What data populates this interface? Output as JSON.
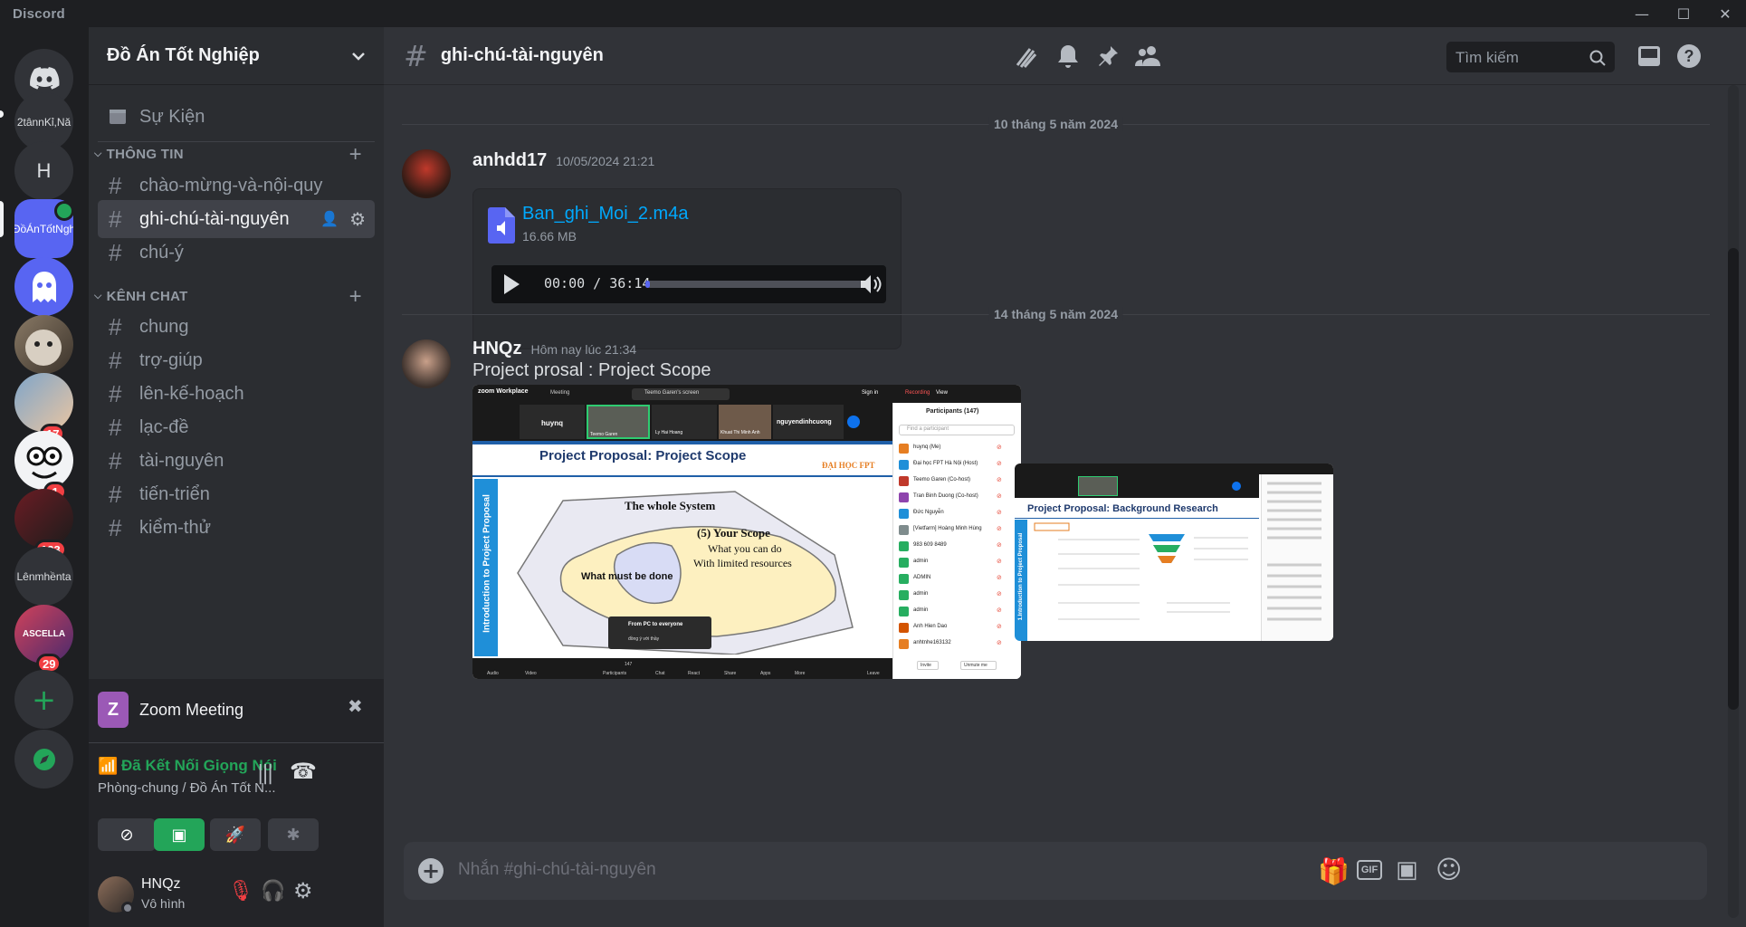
{
  "window": {
    "brand": "Discord",
    "minimize_glyph": "—",
    "maximize_glyph": "☐",
    "close_glyph": "✕"
  },
  "guilds": [
    {
      "label": "2tânnKỉ,Nă",
      "kind": "text"
    },
    {
      "label": "H",
      "kind": "letter"
    },
    {
      "label": "ĐồÁnTốtNgh",
      "kind": "text-active"
    },
    {
      "label": "",
      "kind": "ghost"
    },
    {
      "label": "",
      "kind": "avatar"
    },
    {
      "label": "",
      "kind": "avatar",
      "badge": "17"
    },
    {
      "label": "",
      "kind": "avatar",
      "badge": "1"
    },
    {
      "label": "",
      "kind": "avatar",
      "badge": "133"
    },
    {
      "label": "Lênmhềnta",
      "kind": "text"
    },
    {
      "label": "ASCELLA",
      "kind": "avatar",
      "badge": "29"
    }
  ],
  "server": {
    "name": "Đồ Án Tốt Nghiệp"
  },
  "sidebar": {
    "events": "Sự Kiện",
    "categories": [
      {
        "name": "THÔNG TIN",
        "channels": [
          "chào-mừng-và-nội-quy",
          "ghi-chú-tài-nguyên",
          "chú-ý"
        ]
      },
      {
        "name": "KÊNH CHAT",
        "channels": [
          "chung",
          "trợ-giúp",
          "lên-kế-hoạch",
          "lạc-đề",
          "tài-nguyên",
          "tiến-triển",
          "kiểm-thử"
        ]
      }
    ]
  },
  "activity": {
    "title": "Zoom Meeting",
    "icon_letter": "Z"
  },
  "voice": {
    "status": "Đã Kết Nối Giọng Nói",
    "location": "Phòng-chung / Đồ Án Tốt N..."
  },
  "user": {
    "name": "HNQz",
    "status": "Vô hình"
  },
  "channel": {
    "name": "ghi-chú-tài-nguyên"
  },
  "search": {
    "placeholder": "Tìm kiếm"
  },
  "messages": {
    "divider1": "10 tháng 5 năm 2024",
    "m1": {
      "author": "anhdd17",
      "timestamp": "10/05/2024 21:21",
      "file_name": "Ban_ghi_Moi_2.m4a",
      "file_size": "16.66 MB",
      "time": "00:00 / 36:14",
      "progress": 0.02
    },
    "divider2": "14 tháng 5 năm 2024",
    "m2": {
      "author": "HNQz",
      "timestamp": "Hôm nay lúc 21:34",
      "text": "Project prosal : Project Scope",
      "shot1": {
        "brand": "zoom Workplace",
        "meeting": "Meeting",
        "share_banner": "Teemo Garen's screen",
        "sign_in": "Sign in",
        "recording": "Recording",
        "view": "View",
        "tiles": [
          "huynq",
          "Teemo Garen",
          "Ly Hai Hoang",
          "Khuat Thi Minh Anh",
          "nguyendinhcuong"
        ],
        "slide_title": "Project Proposal: Project Scope",
        "logo_text": "ĐẠI HỌC FPT",
        "side_text": "Introduction to Project Proposal",
        "whole": "The whole System",
        "scope": "(5) Your Scope",
        "scope2": "What you can do",
        "scope3": "With limited resources",
        "must": "What must be done",
        "chat_popup_title": "From PC to everyone",
        "chat_popup_text": "đồng ý với thầy",
        "participants_title": "Participants (147)",
        "find": "Find a participant",
        "participants": [
          "huynq (Me)",
          "Đại học FPT Hà Nội (Host)",
          "Teemo Garen (Co-host)",
          "Tran Binh Duong (Co-host)",
          "Đức Nguyễn",
          "[Vietfarm] Hoàng Minh Hùng",
          "983 609 8489",
          "admin",
          "ADMIN",
          "admin",
          "admin",
          "Anh Hien Dao",
          "anhtnhe163132"
        ],
        "invite": "Invite",
        "unmute": "Unmute me",
        "toolbar": [
          "Audio",
          "Video",
          "Participants",
          "Chat",
          "React",
          "Share",
          "Apps",
          "More",
          "Leave"
        ],
        "participants_count": "147"
      },
      "shot2": {
        "slide_title": "Project Proposal: Background Research",
        "side_text": "1.Introduction to Project Proposal"
      }
    }
  },
  "composer": {
    "placeholder": "Nhắn #ghi-chú-tài-nguyên",
    "gif": "GIF"
  },
  "colors": {
    "accent": "#5865f2",
    "green": "#23a559",
    "red": "#f23f43",
    "link": "#00a8fc"
  }
}
